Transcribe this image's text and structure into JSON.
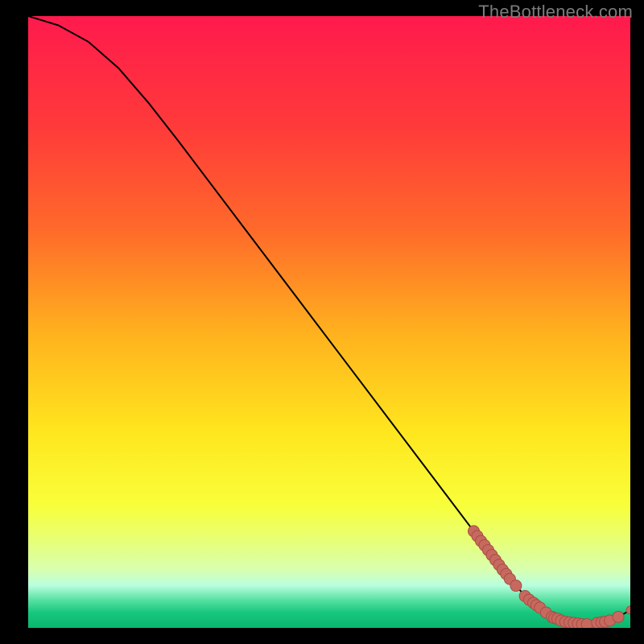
{
  "watermark": "TheBottleneck.com",
  "colors": {
    "background": "#000000",
    "gradient_stops": [
      {
        "offset": 0.0,
        "color": "#ff1a4d"
      },
      {
        "offset": 0.18,
        "color": "#ff3a3a"
      },
      {
        "offset": 0.35,
        "color": "#ff6a2a"
      },
      {
        "offset": 0.52,
        "color": "#ffb21e"
      },
      {
        "offset": 0.68,
        "color": "#ffe61e"
      },
      {
        "offset": 0.8,
        "color": "#f8ff3a"
      },
      {
        "offset": 0.86,
        "color": "#e6ff7a"
      },
      {
        "offset": 0.905,
        "color": "#d8ffb0"
      },
      {
        "offset": 0.93,
        "color": "#baffe0"
      },
      {
        "offset": 0.955,
        "color": "#55e0a0"
      },
      {
        "offset": 0.975,
        "color": "#17c77d"
      },
      {
        "offset": 1.0,
        "color": "#0bb56e"
      }
    ],
    "curve": "#000000",
    "marker_fill": "#c7695e",
    "marker_stroke": "#a74e46"
  },
  "chart_data": {
    "type": "line",
    "title": "",
    "xlabel": "",
    "ylabel": "",
    "xlim": [
      0,
      100
    ],
    "ylim": [
      0,
      100
    ],
    "curve": {
      "x": [
        0,
        5,
        10,
        15,
        20,
        25,
        30,
        35,
        40,
        45,
        50,
        55,
        60,
        65,
        70,
        75,
        80,
        82,
        84,
        86,
        88,
        90,
        92,
        94,
        96,
        98,
        100
      ],
      "y": [
        100,
        98.5,
        95.8,
        91.5,
        85.8,
        79.5,
        73.0,
        66.5,
        60.0,
        53.5,
        47.0,
        40.5,
        34.0,
        27.5,
        21.0,
        14.5,
        8.0,
        5.8,
        3.8,
        2.5,
        1.5,
        0.9,
        0.6,
        0.7,
        1.1,
        1.8,
        2.9
      ]
    },
    "series": [
      {
        "name": "markers",
        "type": "scatter",
        "x": [
          74,
          74.6,
          75.2,
          75.8,
          76.4,
          77,
          77.6,
          78.2,
          78.8,
          79.4,
          80,
          81,
          82.5,
          83.2,
          83.9,
          84.4,
          85.0,
          86.0,
          87.0,
          87.4,
          87.9,
          88.5,
          89.2,
          89.9,
          90.6,
          91.3,
          92.0,
          92.8,
          94.5,
          95.2,
          95.8,
          96.6,
          98.0,
          100.0
        ],
        "y": [
          15.8,
          15.0,
          14.2,
          13.5,
          12.7,
          11.9,
          11.1,
          10.3,
          9.5,
          8.8,
          8.0,
          6.9,
          5.2,
          4.6,
          4.1,
          3.7,
          3.3,
          2.5,
          1.8,
          1.6,
          1.5,
          1.2,
          1.0,
          0.9,
          0.8,
          0.7,
          0.6,
          0.6,
          0.8,
          0.9,
          1.0,
          1.2,
          1.8,
          2.9
        ]
      }
    ]
  }
}
